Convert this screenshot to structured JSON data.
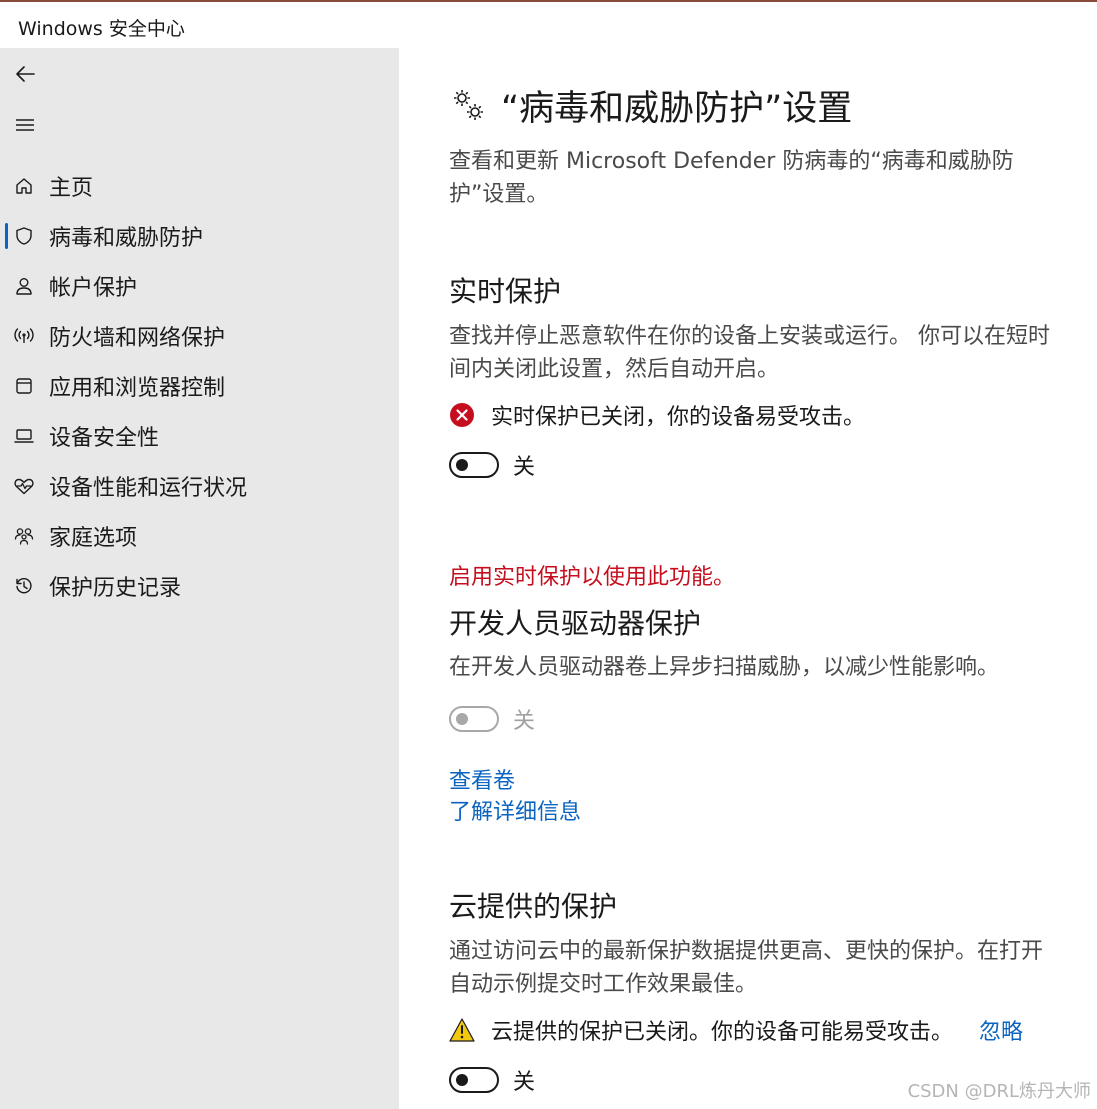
{
  "window": {
    "title": "Windows 安全中心"
  },
  "sidebar": {
    "items": [
      {
        "label": "主页",
        "icon": "home-icon"
      },
      {
        "label": "病毒和威胁防护",
        "icon": "shield-icon",
        "selected": true
      },
      {
        "label": "帐户保护",
        "icon": "person-icon"
      },
      {
        "label": "防火墙和网络保护",
        "icon": "wifi-signal-icon"
      },
      {
        "label": "应用和浏览器控制",
        "icon": "app-window-icon"
      },
      {
        "label": "设备安全性",
        "icon": "laptop-icon"
      },
      {
        "label": "设备性能和运行状况",
        "icon": "heart-pulse-icon"
      },
      {
        "label": "家庭选项",
        "icon": "family-icon"
      },
      {
        "label": "保护历史记录",
        "icon": "history-icon"
      }
    ]
  },
  "main": {
    "title": "“病毒和威胁防护”设置",
    "description": "查看和更新 Microsoft Defender 防病毒的“病毒和威胁防护”设置。",
    "realtime": {
      "heading": "实时保护",
      "description": "查找并停止恶意软件在你的设备上安装或运行。 你可以在短时间内关闭此设置，然后自动开启。",
      "status": "实时保护已关闭，你的设备易受攻击。",
      "toggle_label": "关"
    },
    "devdrive": {
      "warning": "启用实时保护以使用此功能。",
      "heading": "开发人员驱动器保护",
      "description": "在开发人员驱动器卷上异步扫描威胁，以减少性能影响。",
      "toggle_label": "关",
      "link_view": "查看卷",
      "link_learn": "了解详细信息"
    },
    "cloud": {
      "heading": "云提供的保护",
      "description": "通过访问云中的最新保护数据提供更高、更快的保护。在打开自动示例提交时工作效果最佳。",
      "status": "云提供的保护已关闭。你的设备可能易受攻击。",
      "dismiss": "忽略",
      "toggle_label": "关"
    }
  },
  "watermark": "CSDN @DRL炼丹大师",
  "colors": {
    "accent": "#0a64c0",
    "error": "#c50f1f",
    "warning": "#f2c811",
    "sidebar_bg": "#e8e8e8"
  }
}
